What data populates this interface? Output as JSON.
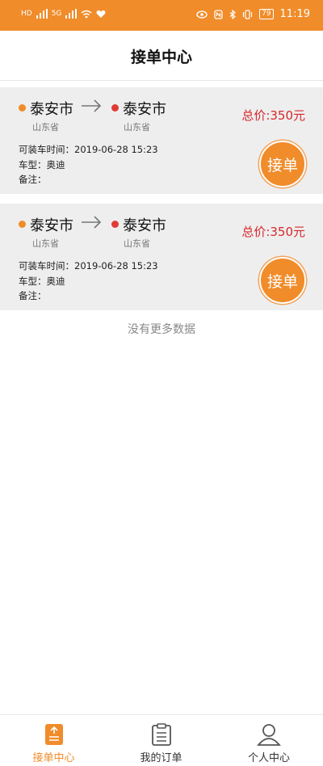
{
  "status_bar": {
    "time": "11:19",
    "battery": "79",
    "net_left": "HD",
    "net_sub": "5G"
  },
  "header": {
    "title": "接单中心"
  },
  "orders": [
    {
      "from_city": "泰安市",
      "from_province": "山东省",
      "to_city": "泰安市",
      "to_province": "山东省",
      "price": "总价:350元",
      "load_time": "可装车时间：2019-06-28 15:23",
      "car_type": "车型：奥迪",
      "remark": "备注：",
      "action_label": "接单"
    },
    {
      "from_city": "泰安市",
      "from_province": "山东省",
      "to_city": "泰安市",
      "to_province": "山东省",
      "price": "总价:350元",
      "load_time": "可装车时间：2019-06-28 15:23",
      "car_type": "车型：奥迪",
      "remark": "备注：",
      "action_label": "接单"
    }
  ],
  "no_more_text": "没有更多数据",
  "tabs": [
    {
      "label": "接单中心",
      "active": true
    },
    {
      "label": "我的订单",
      "active": false
    },
    {
      "label": "个人中心",
      "active": false
    }
  ],
  "colors": {
    "accent": "#f08c2a",
    "price": "#d7282c",
    "destination_dot": "#e03a36"
  }
}
